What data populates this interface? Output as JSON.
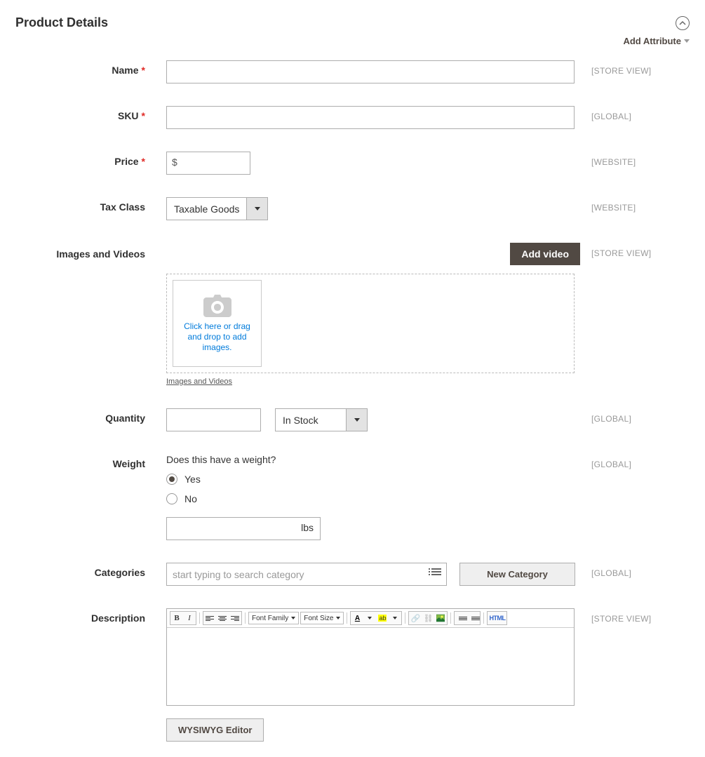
{
  "section_title": "Product Details",
  "add_attribute_label": "Add Attribute",
  "fields": {
    "name": {
      "label": "Name",
      "value": "",
      "scope": "[STORE VIEW]"
    },
    "sku": {
      "label": "SKU",
      "value": "",
      "scope": "[GLOBAL]"
    },
    "price": {
      "label": "Price",
      "currency": "$",
      "value": "",
      "scope": "[WEBSITE]"
    },
    "tax_class": {
      "label": "Tax Class",
      "selected": "Taxable Goods",
      "scope": "[WEBSITE]"
    },
    "images": {
      "label": "Images and Videos",
      "add_video": "Add video",
      "upload_text": "Click here or drag and drop to add images.",
      "link": "Images and Videos",
      "scope": "[STORE VIEW]"
    },
    "quantity": {
      "label": "Quantity",
      "value": "",
      "stock_status": "In Stock",
      "scope": "[GLOBAL]"
    },
    "weight": {
      "label": "Weight",
      "question": "Does this have a weight?",
      "yes": "Yes",
      "no": "No",
      "selected": "yes",
      "value": "",
      "unit": "lbs",
      "scope": "[GLOBAL]"
    },
    "categories": {
      "label": "Categories",
      "placeholder": "start typing to search category",
      "new_category": "New Category",
      "scope": "[GLOBAL]"
    },
    "description": {
      "label": "Description",
      "scope": "[STORE VIEW]",
      "wysiwyg_btn": "WYSIWYG Editor",
      "font_family": "Font Family",
      "font_size": "Font Size",
      "html_btn": "HTML"
    }
  }
}
